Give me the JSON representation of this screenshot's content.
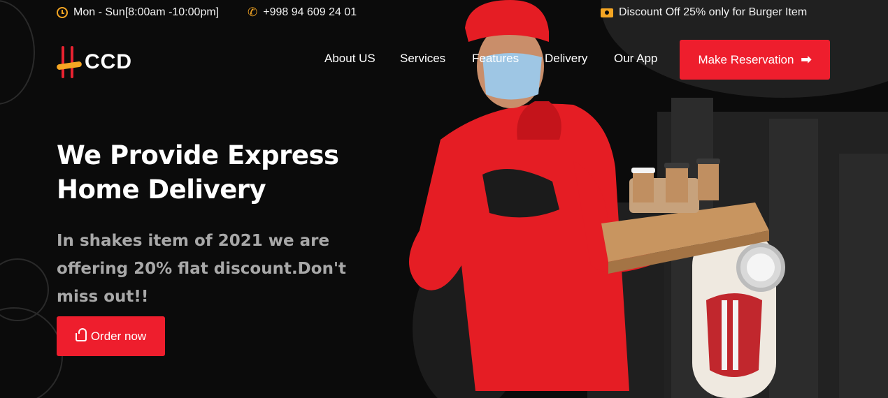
{
  "topbar": {
    "hours": "Mon - Sun[8:00am -10:00pm]",
    "phone": "+998 94 609 24 01",
    "discount": "Discount Off 25% only for Burger Item"
  },
  "brand": {
    "logo_text": "CCD"
  },
  "nav": {
    "items": [
      "About US",
      "Services",
      "Features",
      "Delivery",
      "Our App"
    ],
    "cta_label": "Make Reservation"
  },
  "hero": {
    "title_line1": "We Provide Express",
    "title_line2": "Home Delivery",
    "subtitle": "In shakes item of 2021 we are offering 20% flat discount.Don't miss out!!",
    "order_label": "Order now"
  },
  "colors": {
    "accent": "#ee1e2d",
    "highlight": "#f5a623",
    "background": "#0b0b0b"
  },
  "icons": {
    "hours": "clock-icon",
    "phone": "phone-icon",
    "discount": "ticket-icon",
    "reserve": "arrow-right-icon",
    "order": "basket-icon"
  }
}
